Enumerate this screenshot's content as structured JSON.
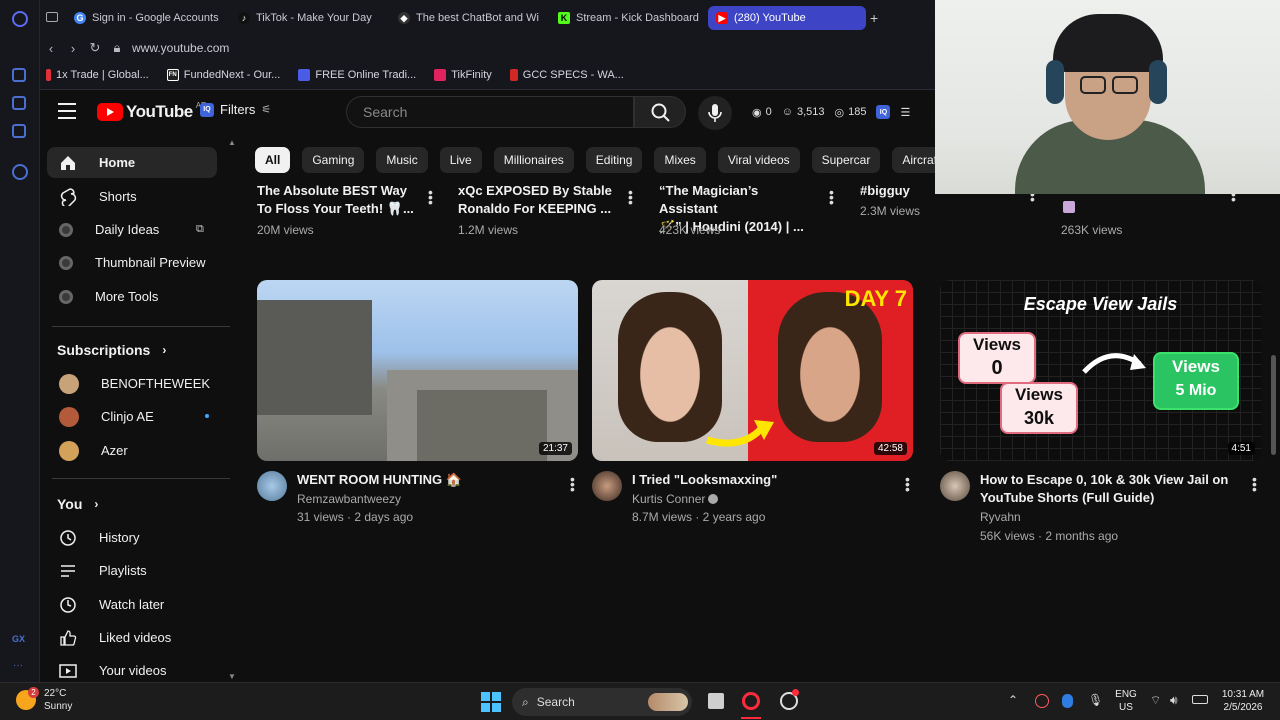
{
  "browser": {
    "tabs": [
      {
        "label": "Sign in - Google Accounts",
        "icon": "google-icon",
        "color": "#4285f4"
      },
      {
        "label": "TikTok - Make Your Day",
        "icon": "tiktok-icon",
        "color": "#ffffff"
      },
      {
        "label": "The best ChatBot and Wi",
        "icon": "chatbot-icon",
        "color": "#ffffff"
      },
      {
        "label": "Stream - Kick Dashboard",
        "icon": "kick-icon",
        "color": "#53fc18"
      },
      {
        "label": "(280) YouTube",
        "icon": "youtube-icon",
        "color": "#ff0000",
        "active": true
      }
    ],
    "new_tab": "+",
    "url": "www.youtube.com",
    "bookmarks": [
      {
        "label": "1x Trade | Global...",
        "icon": "1x-icon",
        "color": "#e0313a"
      },
      {
        "label": "FundedNext - Our...",
        "icon": "fundednext-icon",
        "color": "#ffffff"
      },
      {
        "label": "FREE Online Tradi...",
        "icon": "trading-icon",
        "color": "#4b5ce6"
      },
      {
        "label": "TikFinity",
        "icon": "tikfinity-icon",
        "color": "#e0225f"
      },
      {
        "label": "GCC SPECS - WA...",
        "icon": "gcc-icon",
        "color": "#d02727"
      }
    ]
  },
  "header": {
    "logo": "YouTube",
    "region": "AE",
    "filters": "Filters",
    "iq_badge": "IQ",
    "search_placeholder": "Search",
    "stats": {
      "views": "0",
      "subscribers": "3,513",
      "coins": "185"
    }
  },
  "sidebar": {
    "main": [
      {
        "label": "Home",
        "icon": "home-icon",
        "active": true
      },
      {
        "label": "Shorts",
        "icon": "shorts-icon"
      },
      {
        "label": "Daily Ideas",
        "icon": "iq-icon"
      },
      {
        "label": "Thumbnail Preview",
        "icon": "iq-icon"
      },
      {
        "label": "More Tools",
        "icon": "iq-icon"
      }
    ],
    "subscriptions_title": "Subscriptions",
    "subscriptions": [
      {
        "label": "BENOFTHEWEEK",
        "color": "#c7a37a"
      },
      {
        "label": "Clinjo AE",
        "color": "#b35a3a"
      },
      {
        "label": "Azer",
        "color": "#d4a15a"
      }
    ],
    "you_title": "You",
    "you": [
      {
        "label": "History",
        "icon": "history-icon"
      },
      {
        "label": "Playlists",
        "icon": "playlists-icon"
      },
      {
        "label": "Watch later",
        "icon": "watch-later-icon"
      },
      {
        "label": "Liked videos",
        "icon": "liked-icon"
      },
      {
        "label": "Your videos",
        "icon": "your-videos-icon"
      }
    ]
  },
  "chips": [
    "All",
    "Gaming",
    "Music",
    "Live",
    "Millionaires",
    "Editing",
    "Mixes",
    "Viral videos",
    "Supercar",
    "Aircraft"
  ],
  "top_row": [
    {
      "title1": "The Absolute BEST Way",
      "title2": "To Floss Your Teeth! 🦷...",
      "meta": "20M views"
    },
    {
      "title1": "xQc EXPOSED By Stable",
      "title2": "Ronaldo For KEEPING ...",
      "meta": "1.2M views"
    },
    {
      "title1": "“The Magician’s Assistant",
      "title2": "🪄” | Houdini (2014) | ...",
      "meta": "423K views"
    },
    {
      "title1": "#bigguy",
      "title2": "",
      "meta": "2.3M views"
    },
    {
      "title1": "",
      "title2": "",
      "meta": "263K views"
    }
  ],
  "videos": [
    {
      "title1": "WENT ROOM HUNTING 🏠",
      "title2": "",
      "channel": "Remzawbantweezy",
      "meta": "31 views · 2 days ago",
      "duration": "21:37"
    },
    {
      "title1": "I Tried \"Looksmaxxing\"",
      "title2": "",
      "channel": "Kurtis Conner",
      "meta": "8.7M views · 2 years ago",
      "duration": "42:58",
      "badge": "DAY 7"
    },
    {
      "title1": "How to Escape 0, 10k & 30k View Jail on",
      "title2": "YouTube Shorts (Full Guide)",
      "channel": "Ryvahn",
      "meta": "56K views · 2 months ago",
      "duration": "4:51",
      "thumb_text": {
        "heading": "Escape View Jails",
        "label": "Views",
        "v1": "0",
        "v2": "30k",
        "v3": "5 Mio"
      }
    }
  ],
  "taskbar": {
    "temp": "22°C",
    "condition": "Sunny",
    "notif": "2",
    "search": "Search",
    "lang1": "ENG",
    "lang2": "US",
    "time": "10:31 AM",
    "date": "2/5/2026"
  }
}
